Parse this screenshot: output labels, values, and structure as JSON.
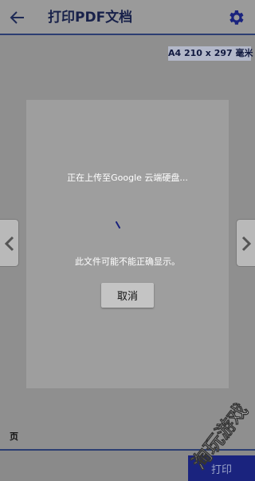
{
  "header": {
    "title": "打印PDF文档",
    "back_icon": "arrow-left-icon",
    "settings_icon": "gear-icon"
  },
  "paper_size": "A4 210 x 297 毫米",
  "dialog": {
    "uploading_text": "正在上传至Google 云端硬盘...",
    "warning_text": "此文件可能不能正确显示。",
    "cancel_label": "取消"
  },
  "navigation": {
    "prev_icon": "chevron-left-icon",
    "next_icon": "chevron-right-icon"
  },
  "footer": {
    "page_label": "页",
    "print_label": "打印"
  },
  "watermark": "淘玩游戏",
  "colors": {
    "accent": "#1a237e",
    "overlay": "#8f8f8f"
  }
}
